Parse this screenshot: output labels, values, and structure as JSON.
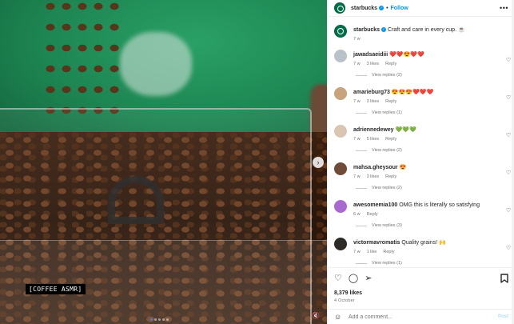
{
  "media": {
    "caption_tag": "[COFFEE ASMR]",
    "carousel_dots": 5,
    "active_dot": 1
  },
  "header": {
    "username": "starbucks",
    "follow_label": "Follow"
  },
  "post": {
    "username": "starbucks",
    "caption": "Craft and care in every cup. ☕",
    "age": "7 w"
  },
  "comments": [
    {
      "username": "jawadsaeidiii",
      "text": "❤️❤️😍❤️❤️",
      "age": "7 w",
      "likes": "3 likes",
      "reply": "Reply",
      "view_replies": "View replies (2)",
      "avatar_color": "#b9c2c9"
    },
    {
      "username": "amarieburg73",
      "text": "😍😍😍❤️❤️❤️",
      "age": "7 w",
      "likes": "3 likes",
      "reply": "Reply",
      "view_replies": "View replies (1)",
      "avatar_color": "#c9a27e"
    },
    {
      "username": "adriennedewey",
      "text": "💚💚💚",
      "age": "7 w",
      "likes": "5 likes",
      "reply": "Reply",
      "view_replies": "View replies (2)",
      "avatar_color": "#d8c6b3"
    },
    {
      "username": "mahsa.gheysour",
      "text": "😍",
      "age": "7 w",
      "likes": "3 likes",
      "reply": "Reply",
      "view_replies": "View replies (2)",
      "avatar_color": "#6f4c3a"
    },
    {
      "username": "awesomemia100",
      "text": "OMG this is literally so satisfying",
      "age": "6 w",
      "likes": "",
      "reply": "Reply",
      "view_replies": "View replies (3)",
      "avatar_color": "#a86ad0"
    },
    {
      "username": "victormavromatis",
      "text": "Quality grains! 🙌",
      "age": "7 w",
      "likes": "1 like",
      "reply": "Reply",
      "view_replies": "View replies (1)",
      "avatar_color": "#2e2a26"
    }
  ],
  "actions": {
    "likes": "8,379 likes",
    "date": "4 October",
    "icons": [
      "heart-icon",
      "comment-icon",
      "share-icon",
      "bookmark-icon"
    ]
  },
  "add_comment": {
    "placeholder": "Add a comment...",
    "post_label": "Post"
  },
  "colors": {
    "accent": "#0095f6",
    "brand": "#00704a"
  }
}
